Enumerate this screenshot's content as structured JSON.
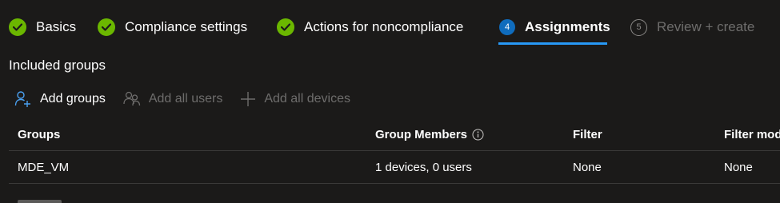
{
  "steps": [
    {
      "label": "Basics",
      "state": "done"
    },
    {
      "label": "Compliance settings",
      "state": "done"
    },
    {
      "label": "Actions for noncompliance",
      "state": "done"
    },
    {
      "number": "4",
      "label": "Assignments",
      "state": "active"
    },
    {
      "number": "5",
      "label": "Review + create",
      "state": "disabled"
    }
  ],
  "section": {
    "title": "Included groups"
  },
  "toolbar": {
    "add_groups": "Add groups",
    "add_all_users": "Add all users",
    "add_all_devices": "Add all devices"
  },
  "table": {
    "columns": [
      "Groups",
      "Group Members",
      "Filter",
      "Filter mod"
    ],
    "rows": [
      [
        "MDE_VM",
        "1 devices, 0 users",
        "None",
        "None"
      ]
    ]
  },
  "colors": {
    "done": "#6bb700",
    "active": "#0f6cbd",
    "underline": "#2899f5",
    "background": "#1b1a19"
  }
}
